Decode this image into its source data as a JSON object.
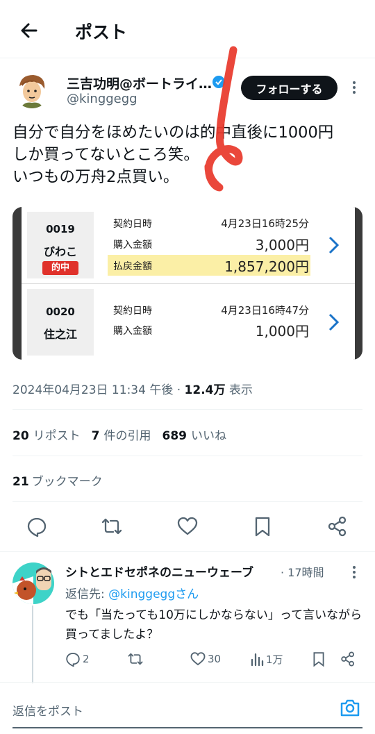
{
  "header": {
    "title": "ポスト"
  },
  "author": {
    "name": "三吉功明@ボートライ…",
    "handle": "@kinggegg"
  },
  "follow_label": "フォローする",
  "tweet": {
    "text": "自分で自分をほめたいのは的中直後に1000円\nしか買ってないところ笑。\nいつもの万舟2点買い。"
  },
  "bets": [
    {
      "race_no": "0019",
      "place": "びわこ",
      "badge": "的中",
      "contract_label": "契約日時",
      "contract_value": "4月23日16時25分",
      "purchase_label": "購入金額",
      "purchase_value": "3,000円",
      "payout_label": "払戻金額",
      "payout_value": "1,857,200円"
    },
    {
      "race_no": "0020",
      "place": "住之江",
      "contract_label": "契約日時",
      "contract_value": "4月23日16時47分",
      "purchase_label": "購入金額",
      "purchase_value": "1,000円"
    }
  ],
  "meta": {
    "datetime": "2024年04月23日 11:34 午後",
    "sep": " · ",
    "views": "12.4万",
    "views_label": " 表示"
  },
  "stats": {
    "reposts": "20",
    "reposts_label": "リポスト",
    "quotes": "7",
    "quotes_label": "件の引用",
    "likes": "689",
    "likes_label": "いいね",
    "bookmarks": "21",
    "bookmarks_label": "ブックマーク"
  },
  "reply": {
    "name": "シトとエドセポネのニューウェーブ",
    "time": "· 17時間",
    "reply_to_prefix": "返信先: ",
    "reply_to_handle": "@kinggeggさん",
    "text": "でも「当たっても10万にしかならない」って言いながら買ってましたよ？",
    "replies": "2",
    "likes": "30",
    "views": "1万"
  },
  "composer": {
    "placeholder": "返信をポスト"
  },
  "icons": [
    "back-arrow-icon",
    "verified-badge-icon",
    "more-icon",
    "chevron-right-icon",
    "reply-icon",
    "retweet-icon",
    "like-icon",
    "bookmark-icon",
    "share-icon",
    "views-icon",
    "camera-icon"
  ],
  "colors": {
    "accent": "#1d9bf0",
    "hit_badge": "#e0322b",
    "payout_highlight": "#fbefa6",
    "red_marker": "#e8392c"
  }
}
